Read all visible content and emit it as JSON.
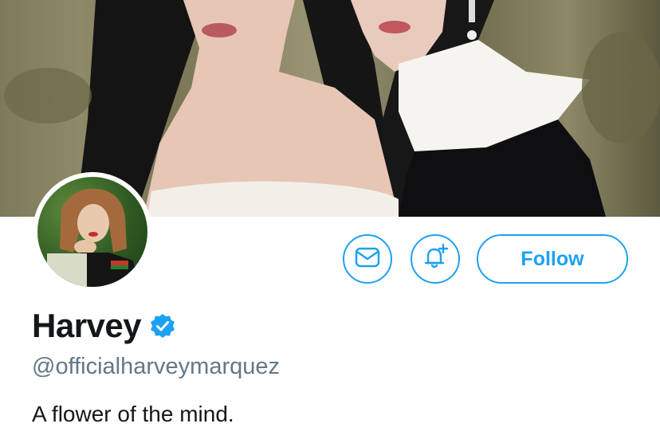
{
  "profile": {
    "display_name": "Harvey",
    "handle": "@officialharveymarquez",
    "bio": "A flower of the mind.",
    "verified": true
  },
  "actions": {
    "message_icon": "envelope-icon",
    "notify_icon": "bell-plus-icon",
    "follow_label": "Follow"
  },
  "colors": {
    "accent": "#1da1f2",
    "text": "#14171a",
    "secondary_text": "#657786"
  }
}
